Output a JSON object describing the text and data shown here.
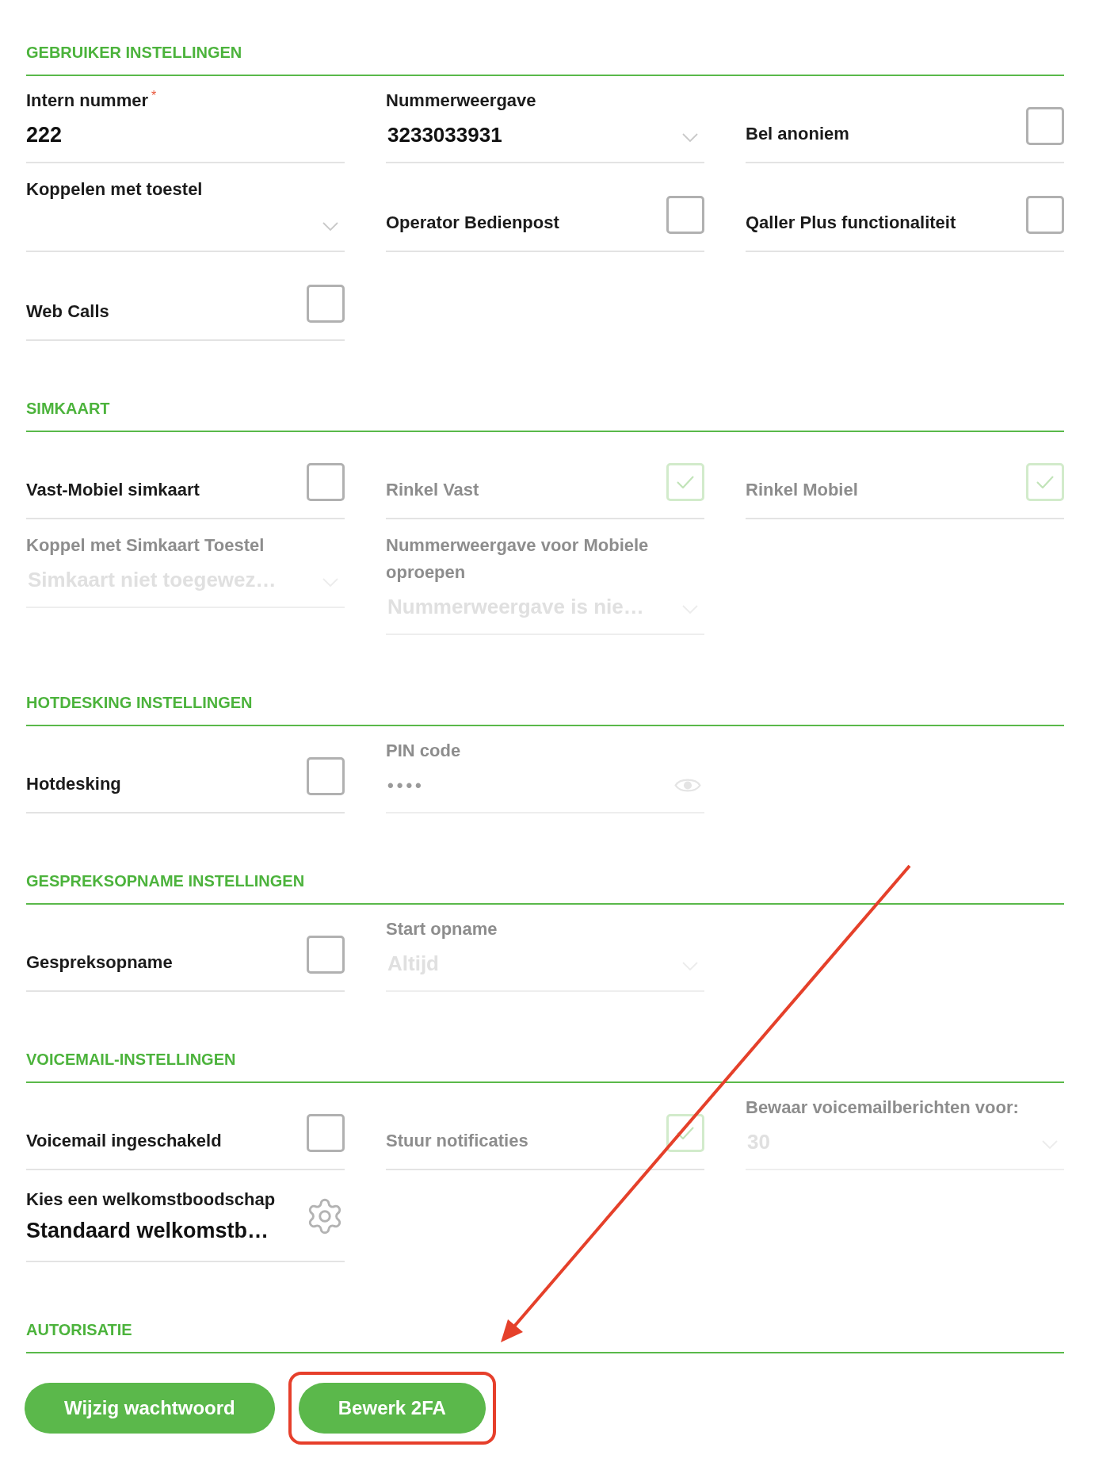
{
  "sections": [
    {
      "title": "GEBRUIKER INSTELLINGEN",
      "rows": [
        [
          {
            "kind": "text",
            "label": "Intern nummer",
            "required_mark": "*",
            "value": "222",
            "disabled": false
          },
          {
            "kind": "select",
            "label": "Nummerweergave",
            "value": "3233033931",
            "disabled": false
          },
          {
            "kind": "checkbox",
            "label": "Bel anoniem",
            "checked": false,
            "disabled": false
          }
        ],
        [
          {
            "kind": "select",
            "label": "Koppelen met toestel",
            "disabled": false
          },
          {
            "kind": "checkbox",
            "label": "Operator Bedienpost",
            "checked": false,
            "disabled": false
          },
          {
            "kind": "checkbox",
            "label": "Qaller Plus functionaliteit",
            "checked": false,
            "disabled": false
          }
        ],
        [
          {
            "kind": "checkbox",
            "label": "Web Calls",
            "checked": false,
            "disabled": false
          }
        ]
      ]
    },
    {
      "title": "SIMKAART",
      "rows": [
        [
          {
            "kind": "checkbox",
            "label": "Vast-Mobiel simkaart",
            "checked": false,
            "disabled": false
          },
          {
            "kind": "checkbox",
            "label": "Rinkel Vast",
            "checked": true,
            "disabled": true
          },
          {
            "kind": "checkbox",
            "label": "Rinkel Mobiel",
            "checked": true,
            "disabled": true
          }
        ],
        [
          {
            "kind": "select",
            "label": "Koppel met Simkaart Toestel",
            "value": "Simkaart niet toegewez…",
            "disabled": true
          },
          {
            "kind": "select",
            "label": "Nummerweergave voor Mobiele oproepen",
            "value": "Nummerweergave is nie…",
            "disabled": true
          }
        ]
      ]
    },
    {
      "title": "HOTDESKING INSTELLINGEN",
      "rows": [
        [
          {
            "kind": "checkbox",
            "label": "Hotdesking",
            "checked": false,
            "disabled": false
          },
          {
            "kind": "password",
            "label": "PIN code",
            "value": "••••",
            "disabled": true
          }
        ]
      ]
    },
    {
      "title": "GESPREKSOPNAME INSTELLINGEN",
      "rows": [
        [
          {
            "kind": "checkbox",
            "label": "Gespreksopname",
            "checked": false,
            "disabled": false
          },
          {
            "kind": "select",
            "label": "Start opname",
            "value": "Altijd",
            "disabled": true
          }
        ]
      ]
    },
    {
      "title": "VOICEMAIL-INSTELLINGEN",
      "rows": [
        [
          {
            "kind": "checkbox",
            "label": "Voicemail ingeschakeld",
            "checked": false,
            "disabled": false
          },
          {
            "kind": "checkbox",
            "label": "Stuur notificaties",
            "checked": true,
            "disabled": true
          },
          {
            "kind": "select",
            "label": "Bewaar voicemailberichten voor:",
            "value": "30",
            "disabled": true
          }
        ],
        [
          {
            "kind": "action",
            "label": "Kies een welkomstboodschap",
            "value": "Standaard welkomstb…",
            "disabled": false
          }
        ]
      ]
    },
    {
      "title": "AUTORISATIE",
      "buttons": [
        {
          "label": "Wijzig wachtwoord",
          "highlighted": false
        },
        {
          "label": "Bewerk 2FA",
          "highlighted": true
        }
      ]
    }
  ]
}
